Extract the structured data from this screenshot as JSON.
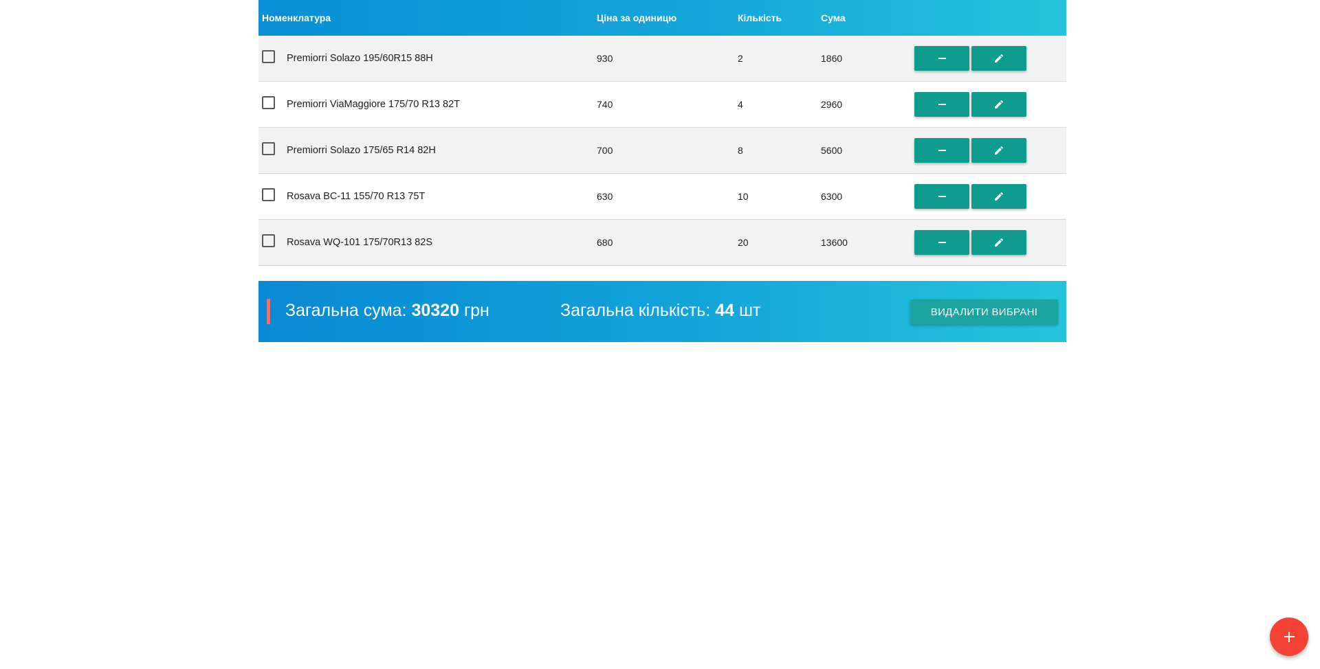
{
  "table": {
    "headers": {
      "name": "Номенклатура",
      "price": "Ціна за одиницю",
      "quantity": "Кількість",
      "sum": "Сума"
    },
    "rows": [
      {
        "name": "Premiorri Solazo 195/60R15 88H",
        "price": "930",
        "quantity": "2",
        "sum": "1860",
        "checked": false
      },
      {
        "name": "Premiorri ViaMaggiore 175/70 R13 82T",
        "price": "740",
        "quantity": "4",
        "sum": "2960",
        "checked": false
      },
      {
        "name": "Premiorri Solazo 175/65 R14 82H",
        "price": "700",
        "quantity": "8",
        "sum": "5600",
        "checked": false
      },
      {
        "name": "Rosava BC-11 155/70 R13 75T",
        "price": "630",
        "quantity": "10",
        "sum": "6300",
        "checked": false
      },
      {
        "name": "Rosava WQ-101 175/70R13 82S",
        "price": "680",
        "quantity": "20",
        "sum": "13600",
        "checked": false
      }
    ],
    "row_actions": {
      "remove_icon": "minus-icon",
      "edit_icon": "pencil-icon"
    }
  },
  "summary": {
    "total_sum_label": "Загальна сума:",
    "total_sum_value": "30320",
    "total_sum_unit": "грн",
    "total_qty_label": "Загальна кількість:",
    "total_qty_value": "44",
    "total_qty_unit": "шт",
    "delete_selected_label": "ВИДАЛИТИ ВИБРАНІ"
  },
  "fab": {
    "icon": "plus-icon"
  },
  "colors": {
    "header_gradient_start": "#0a8fd6",
    "header_gradient_end": "#26c4dc",
    "action_button": "#0f9b8e",
    "fab": "#f44336",
    "summary_marker": "#e57373"
  }
}
